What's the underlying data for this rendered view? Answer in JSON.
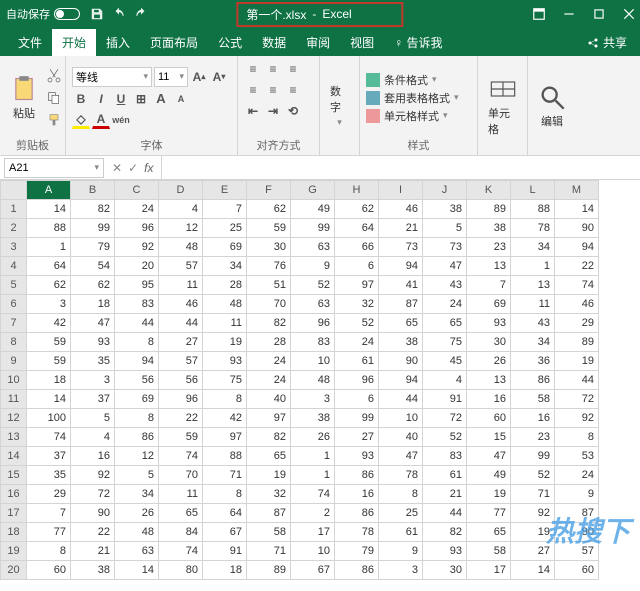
{
  "title": {
    "autosave": "自动保存",
    "file": "第一个.xlsx",
    "app": "Excel"
  },
  "tabs": {
    "file": "文件",
    "home": "开始",
    "insert": "插入",
    "layout": "页面布局",
    "formula": "公式",
    "data": "数据",
    "review": "审阅",
    "view": "视图",
    "tell": "告诉我",
    "share": "共享"
  },
  "groups": {
    "clipboard": "剪贴板",
    "paste": "粘贴",
    "font": "字体",
    "align": "对齐方式",
    "number": "数字",
    "styles": "样式",
    "cells": "单元格",
    "editing": "编辑"
  },
  "font": {
    "name": "等线",
    "size": "11"
  },
  "styles": {
    "cond": "条件格式",
    "tbl": "套用表格格式",
    "cell": "单元格样式"
  },
  "namebox": "A21",
  "columns": [
    "A",
    "B",
    "C",
    "D",
    "E",
    "F",
    "G",
    "H",
    "I",
    "J",
    "K",
    "L",
    "M"
  ],
  "rows": [
    [
      14,
      82,
      24,
      4,
      7,
      62,
      49,
      62,
      46,
      38,
      89,
      88,
      14
    ],
    [
      88,
      99,
      96,
      12,
      25,
      59,
      99,
      64,
      21,
      5,
      38,
      78,
      90
    ],
    [
      1,
      79,
      92,
      48,
      69,
      30,
      63,
      66,
      73,
      73,
      23,
      34,
      94
    ],
    [
      64,
      54,
      20,
      57,
      34,
      76,
      9,
      6,
      94,
      47,
      13,
      1,
      22
    ],
    [
      62,
      62,
      95,
      11,
      28,
      51,
      52,
      97,
      41,
      43,
      7,
      13,
      74
    ],
    [
      3,
      18,
      83,
      46,
      48,
      70,
      63,
      32,
      87,
      24,
      69,
      11,
      46
    ],
    [
      42,
      47,
      44,
      44,
      11,
      82,
      96,
      52,
      65,
      65,
      93,
      43,
      29
    ],
    [
      59,
      93,
      8,
      27,
      19,
      28,
      83,
      24,
      38,
      75,
      30,
      34,
      89
    ],
    [
      59,
      35,
      94,
      57,
      93,
      24,
      10,
      61,
      90,
      45,
      26,
      36,
      19
    ],
    [
      18,
      3,
      56,
      56,
      75,
      24,
      48,
      96,
      94,
      4,
      13,
      86,
      44
    ],
    [
      14,
      37,
      69,
      96,
      8,
      40,
      3,
      6,
      44,
      91,
      16,
      58,
      72
    ],
    [
      100,
      5,
      8,
      22,
      42,
      97,
      38,
      99,
      10,
      72,
      60,
      16,
      92
    ],
    [
      74,
      4,
      86,
      59,
      97,
      82,
      26,
      27,
      40,
      52,
      15,
      23,
      8
    ],
    [
      37,
      16,
      12,
      74,
      88,
      65,
      1,
      93,
      47,
      83,
      47,
      99,
      53
    ],
    [
      35,
      92,
      5,
      70,
      71,
      19,
      1,
      86,
      78,
      61,
      49,
      52,
      24
    ],
    [
      29,
      72,
      34,
      11,
      8,
      32,
      74,
      16,
      8,
      21,
      19,
      71,
      9
    ],
    [
      7,
      90,
      26,
      65,
      64,
      87,
      2,
      86,
      25,
      44,
      77,
      92,
      87
    ],
    [
      77,
      22,
      48,
      84,
      67,
      58,
      17,
      78,
      61,
      82,
      65,
      19,
      90
    ],
    [
      8,
      21,
      63,
      74,
      91,
      71,
      10,
      79,
      9,
      93,
      58,
      27,
      57
    ],
    [
      60,
      38,
      14,
      80,
      18,
      89,
      67,
      86,
      3,
      30,
      17,
      14,
      60
    ]
  ],
  "watermark": "热搜下"
}
